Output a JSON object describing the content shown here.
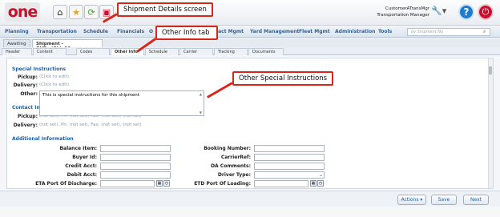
{
  "header": {
    "logo": "one",
    "user_name": "CustomerATransMgr",
    "user_role": "Transportation Manager",
    "search_placeholder": "by Shipment No"
  },
  "nav": {
    "items": [
      "Planning",
      "Transportation",
      "Schedule",
      "Financials",
      "O",
      "ntract Mgmt",
      "Yard Management",
      "Fleet Mgmt",
      "Administration",
      "Tools"
    ]
  },
  "window_tabs": [
    "Awaiting",
    "Shipment - GHTestShip13"
  ],
  "sub_tabs": [
    "Header",
    "Content",
    "Codes",
    "Other Info",
    "Schedule",
    "Carrier",
    "Tracking",
    "Documents"
  ],
  "special_instructions": {
    "title": "Special Instructions",
    "pickup_label": "Pickup:",
    "pickup_value": "(Click to edit)",
    "delivery_label": "Delivery:",
    "delivery_value": "(Click to edit)",
    "other_label": "Other:",
    "other_value": "This is special instructions for this shipment"
  },
  "contact_info": {
    "title": "Contact Informati",
    "pickup_label": "Pickup:",
    "pickup_value": "(not set), Ph: (not set), Fax: (not set), (not set)",
    "delivery_label": "Delivery:",
    "delivery_value": "(not set), Ph: (not set), Fax: (not set), (not set)"
  },
  "additional_info": {
    "title": "Additional Information",
    "left_labels": [
      "Balance Item:",
      "Buyer Id:",
      "Credit Acct:",
      "Debit Acct:",
      "ETA Port Of Discharge:"
    ],
    "right_labels": [
      "Booking Number:",
      "CarrierRef:",
      "DA Comments:",
      "Driver Type:",
      "ETD Port Of Loading:"
    ]
  },
  "buttons": {
    "actions": "Actions ▾",
    "save": "Save",
    "next": "Next"
  },
  "callouts": {
    "screen": "Shipment Details screen",
    "tab": "Other Info tab",
    "instructions": "Other Special Instructions"
  },
  "colors": {
    "callout_border": "#d9261c",
    "section_title": "#1f5fa6",
    "brand": "#c8102e"
  }
}
